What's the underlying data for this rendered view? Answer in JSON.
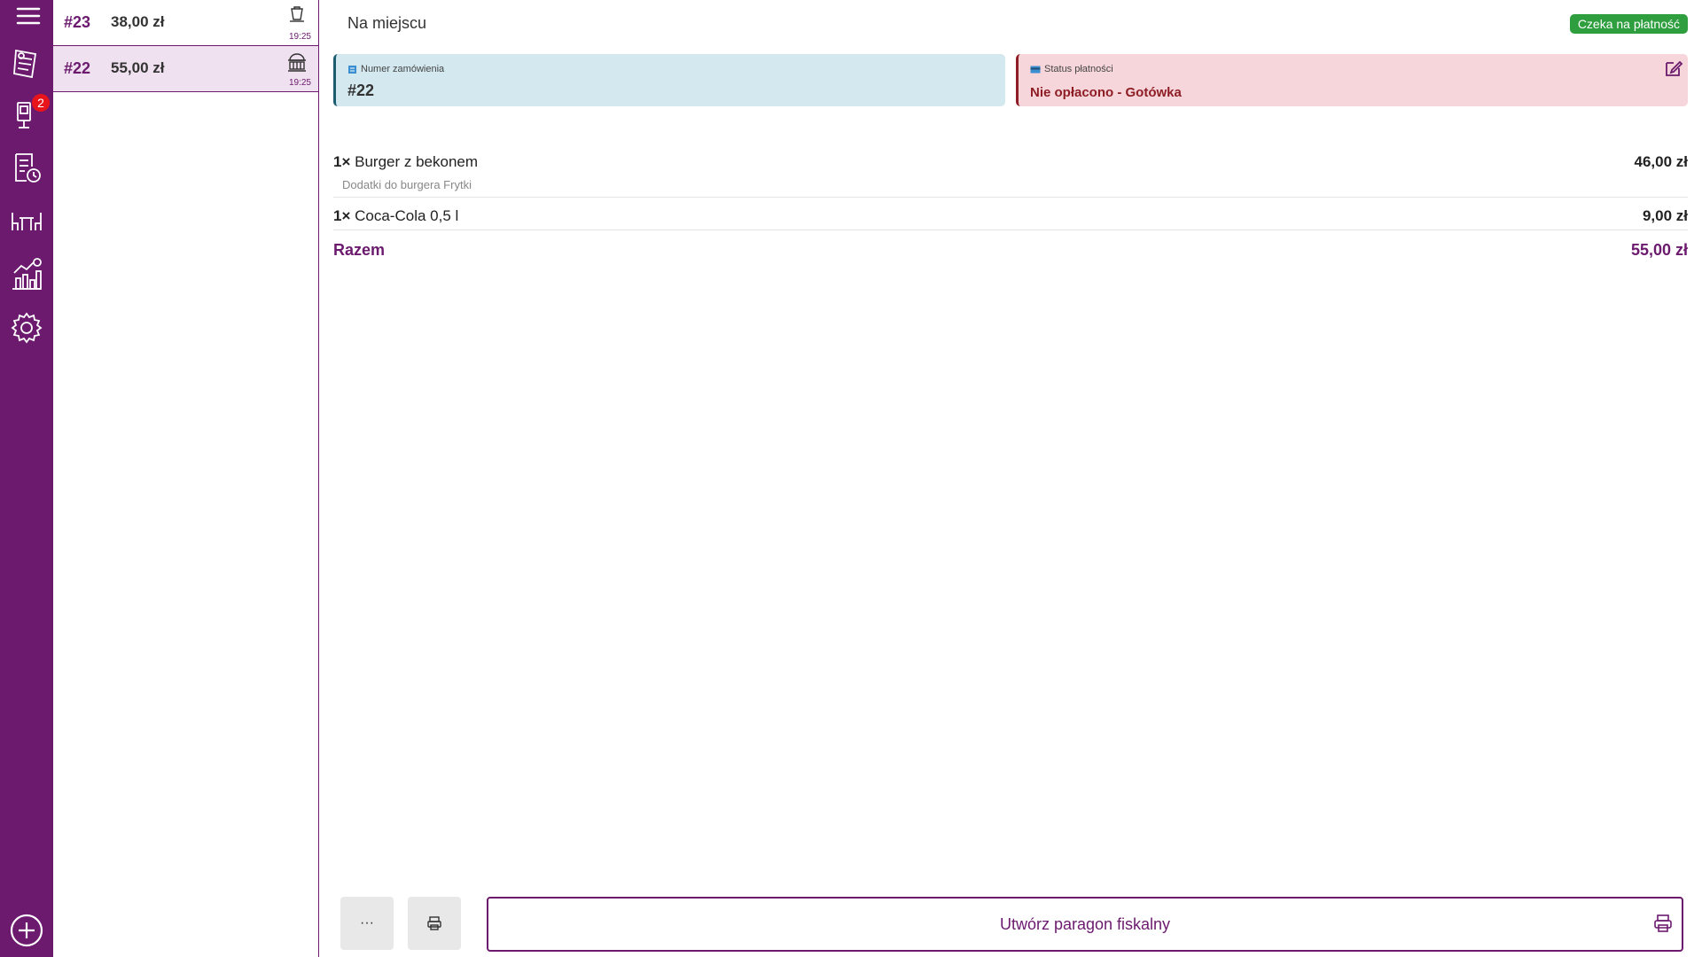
{
  "rail": {
    "background": "#6b1a6e",
    "notifications_badge": "2",
    "items": [
      {
        "icon": "hamburger-menu-icon"
      },
      {
        "icon": "orders-receipt-icon"
      },
      {
        "icon": "kiosk-icon"
      },
      {
        "icon": "order-history-icon"
      },
      {
        "icon": "tables-icon"
      },
      {
        "icon": "statistics-icon"
      },
      {
        "icon": "settings-gear-icon"
      },
      {
        "icon": "add-circle-icon"
      }
    ]
  },
  "orders": [
    {
      "number": "#23",
      "amount": "38,00 zł",
      "time": "19:25",
      "icon": "takeaway-icon",
      "selected": false
    },
    {
      "number": "#22",
      "amount": "55,00 zł",
      "time": "19:25",
      "icon": "dine-in-icon",
      "selected": true
    }
  ],
  "main": {
    "order_type": "Na miejscu",
    "status_badge": "Czeka na płatność",
    "order_card": {
      "label": "Numer zamówienia",
      "value": "#22"
    },
    "payment_card": {
      "label": "Status płatności",
      "value": "Nie opłacono - Gotówka"
    },
    "items": [
      {
        "qty": "1×",
        "name": "Burger z bekonem",
        "price": "46,00 zł",
        "sub": "Dodatki do burgera Frytki"
      },
      {
        "qty": "1×",
        "name": "Coca-Cola 0,5 l",
        "price": "9,00 zł"
      }
    ],
    "total": {
      "label": "Razem",
      "value": "55,00 zł"
    },
    "buttons": {
      "more": "···",
      "fiscal": "Utwórz paragon fiskalny"
    }
  },
  "colors": {
    "primary": "#6b1a6e",
    "status_green": "#2e9e3e",
    "order_card_bg": "#d3e9ef",
    "payment_card_bg": "#f6d6da",
    "payment_text": "#8e1d25",
    "badge_red": "#e8141c"
  }
}
